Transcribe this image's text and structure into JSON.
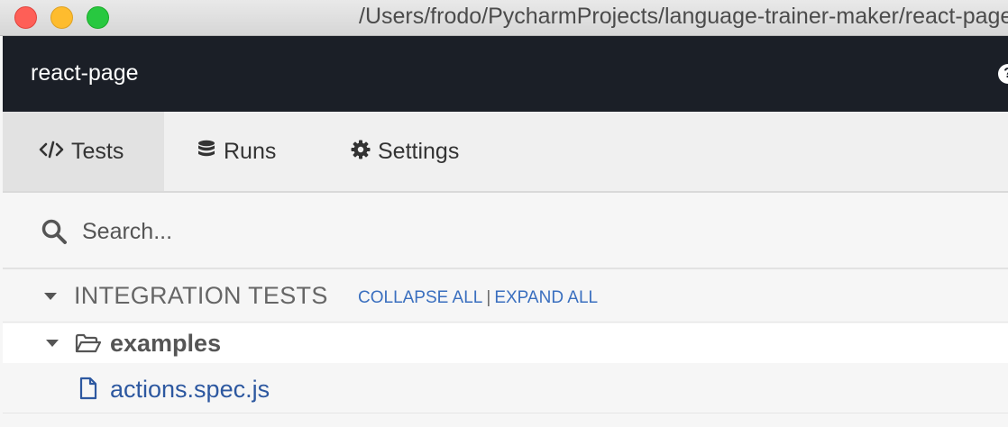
{
  "window": {
    "path": "/Users/frodo/PycharmProjects/language-trainer-maker/react-page"
  },
  "header": {
    "project_name": "react-page",
    "help_glyph": "?"
  },
  "tabs": [
    {
      "label": "Tests",
      "icon": "code-icon",
      "active": true
    },
    {
      "label": "Runs",
      "icon": "database-icon",
      "active": false
    },
    {
      "label": "Settings",
      "icon": "gear-icon",
      "active": false
    }
  ],
  "search": {
    "value": "",
    "placeholder": "Search..."
  },
  "specs": {
    "title": "INTEGRATION TESTS",
    "collapse_all": "COLLAPSE ALL",
    "separator": "|",
    "expand_all": "EXPAND ALL",
    "folder": {
      "name": "examples",
      "icon": "folder-open-icon"
    },
    "files": [
      {
        "name": "actions.spec.js",
        "icon": "file-icon"
      }
    ]
  },
  "colors": {
    "header_bg": "#1b1f27",
    "link": "#3a6fbf",
    "file_link": "#2d58a0",
    "active_tab_bg": "#e2e2e2"
  }
}
